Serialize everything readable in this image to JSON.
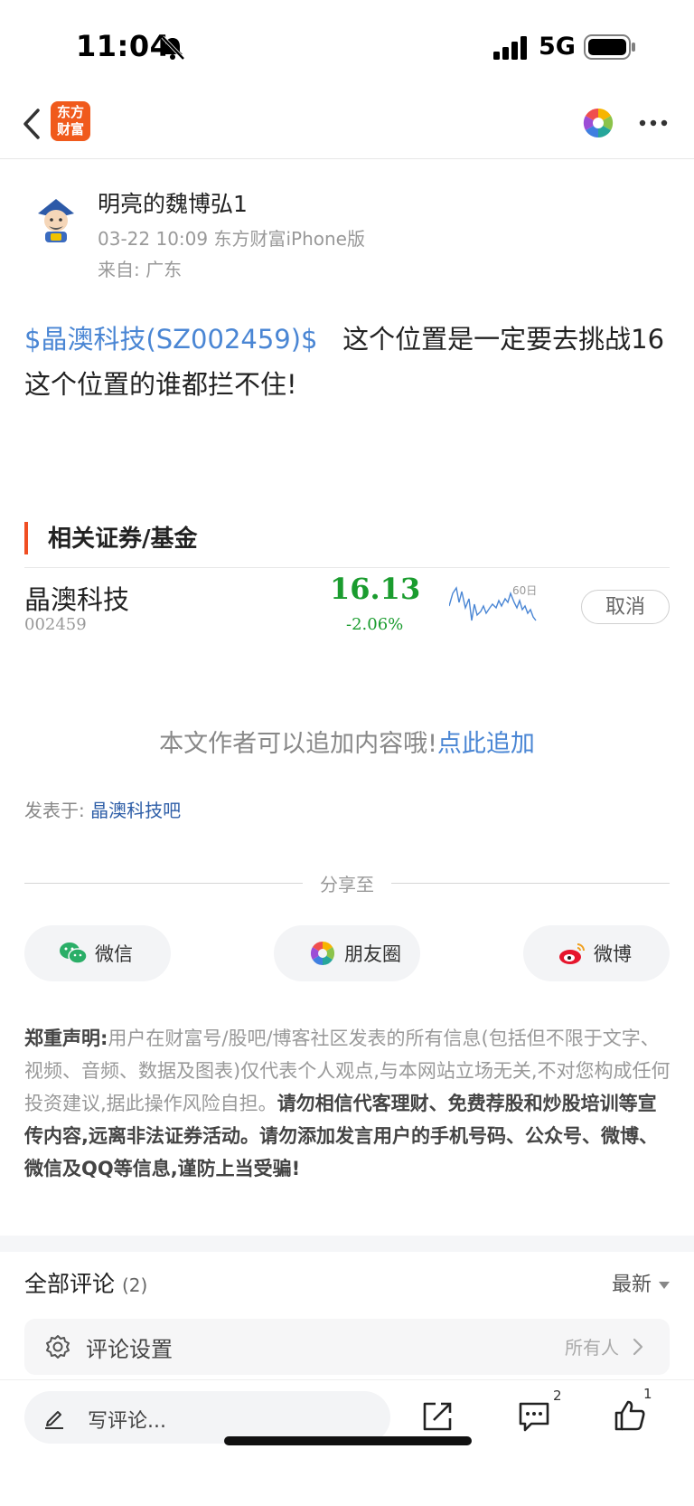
{
  "status_bar": {
    "time": "11:04",
    "network": "5G",
    "icons": [
      "bell-slash-icon",
      "signal-icon",
      "battery-icon"
    ]
  },
  "nav": {
    "logo_line1": "东方",
    "logo_line2": "财富",
    "logo_color": "#f05a1c",
    "icons": [
      "back-icon",
      "share-wheel-icon",
      "more-icon"
    ]
  },
  "author": {
    "name": "明亮的魏博弘1",
    "meta": "03-22 10:09 东方财富iPhone版",
    "location": "来自: 广东"
  },
  "post": {
    "stock_link": "$晶澳科技(SZ002459)$",
    "text": "这个位置是一定要去挑战16这个位置的谁都拦不住!"
  },
  "related": {
    "title": "相关证券/基金",
    "accent_color": "#f04e23",
    "stock": {
      "name": "晶澳科技",
      "code": "002459",
      "price": "16.13",
      "change": "-2.06%",
      "period": "60日",
      "cancel_label": "取消",
      "down_color": "#1a9c2e"
    }
  },
  "append": {
    "text": "本文作者可以追加内容哦!",
    "link": "点此追加"
  },
  "posted_in": {
    "label": "发表于:",
    "link": "晶澳科技吧"
  },
  "share": {
    "label": "分享至",
    "wechat": "微信",
    "moments": "朋友圈",
    "weibo": "微博"
  },
  "disclaimer": {
    "title": "郑重声明:",
    "body": "用户在财富号/股吧/博客社区发表的所有信息(包括但不限于文字、视频、音频、数据及图表)仅代表个人观点,与本网站立场无关,不对您构成任何投资建议,据此操作风险自担。",
    "warning": "请勿相信代客理财、免费荐股和炒股培训等宣传内容,远离非法证券活动。请勿添加发言用户的手机号码、公众号、微博、微信及QQ等信息,谨防上当受骗!"
  },
  "comments": {
    "title": "全部评论",
    "count": "(2)",
    "sort": "最新",
    "settings_label": "评论设置",
    "settings_value": "所有人"
  },
  "bottom_bar": {
    "placeholder": "写评论...",
    "comment_count": "2",
    "like_count": "1"
  },
  "link_color": "#4a86d4"
}
